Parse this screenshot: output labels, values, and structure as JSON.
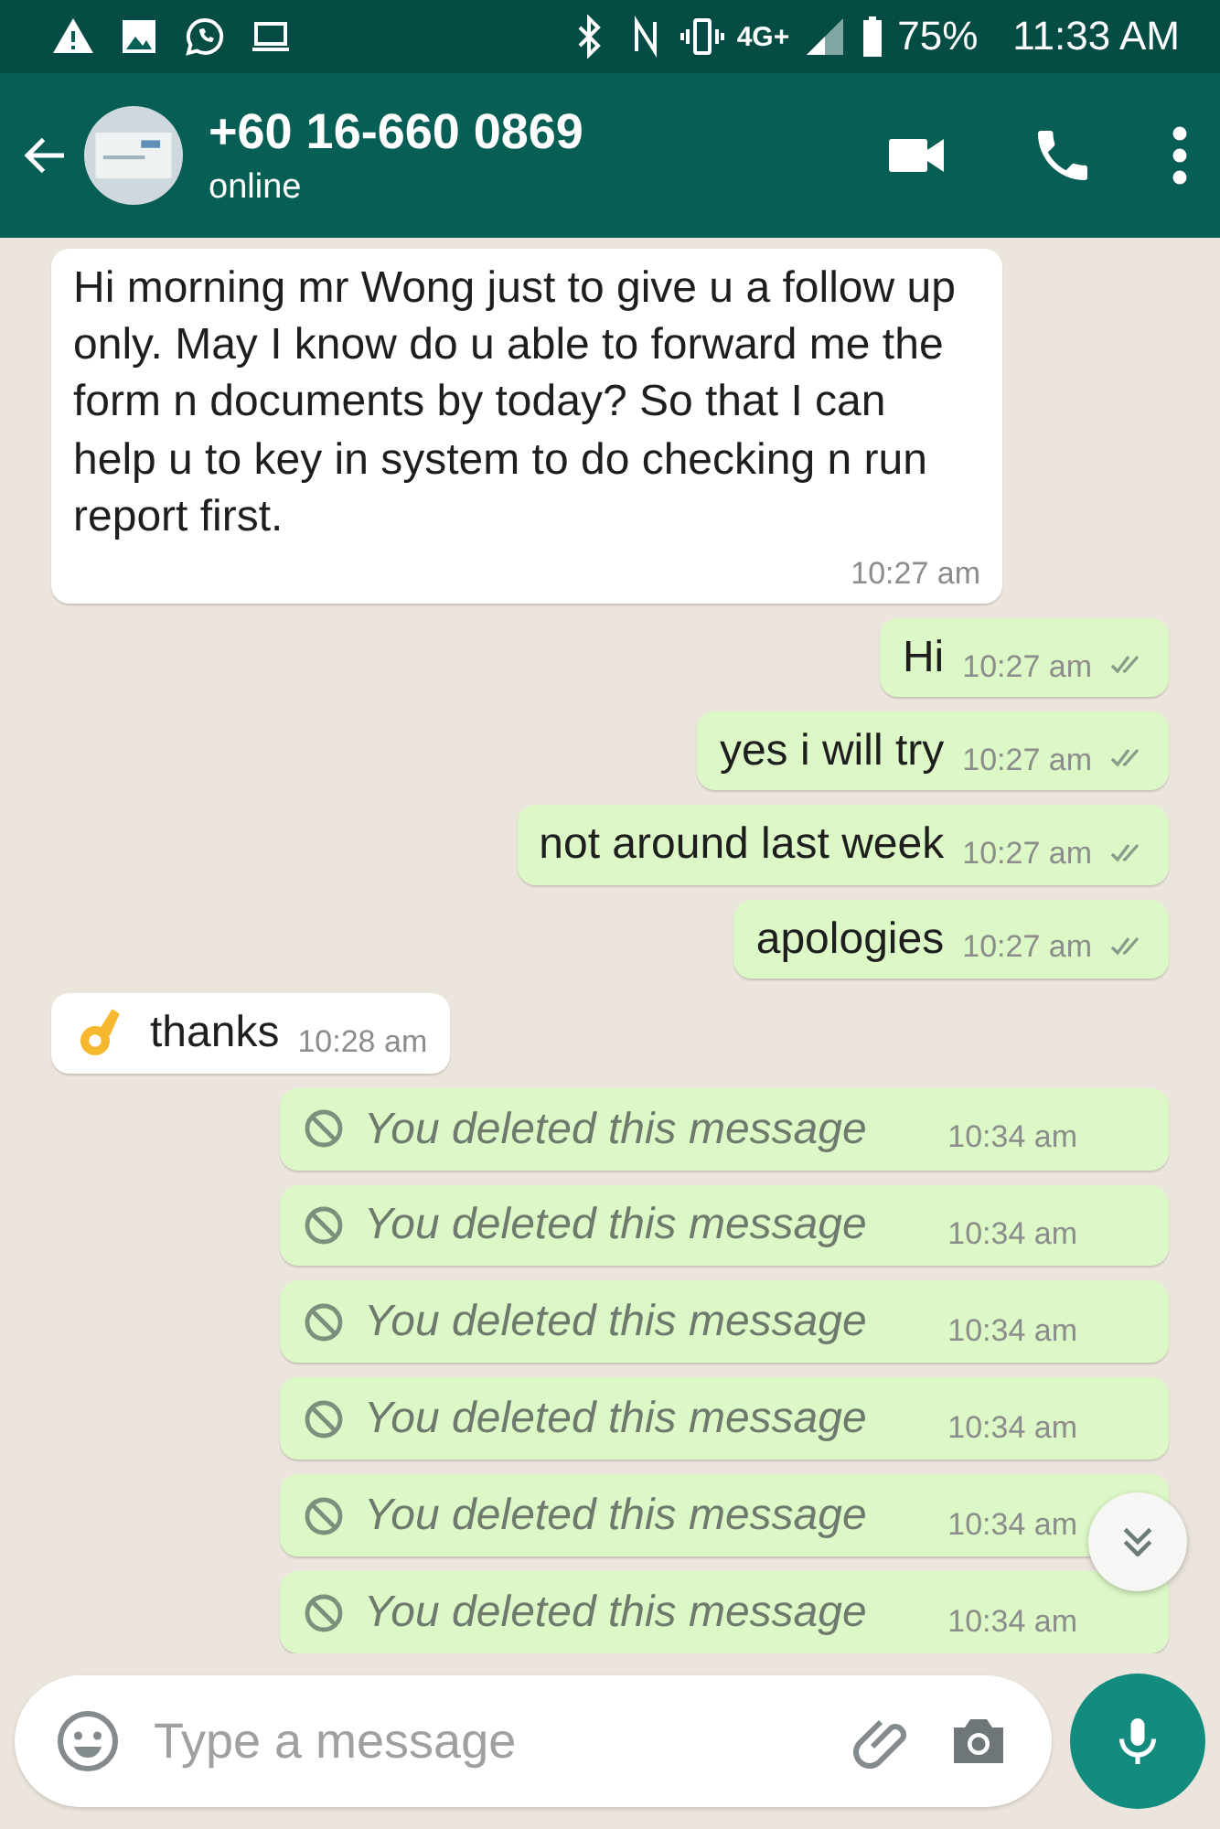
{
  "status_bar": {
    "network": "4G+",
    "battery": "75%",
    "time": "11:33 AM"
  },
  "header": {
    "title": "+60 16-660 0869",
    "subtitle": "online"
  },
  "messages": [
    {
      "kind": "in",
      "text": "Hi morning mr Wong just to give u a follow up only. May I know do u able to forward me the form n documents by today? So that I can help u to key in system to do checking n run report first.",
      "time": "10:27 am"
    },
    {
      "kind": "out",
      "text": "Hi",
      "time": "10:27 am",
      "read": false
    },
    {
      "kind": "out",
      "text": "yes i will try",
      "time": "10:27 am",
      "read": false
    },
    {
      "kind": "out",
      "text": "not around last week",
      "time": "10:27 am",
      "read": false
    },
    {
      "kind": "out",
      "text": "apologies",
      "time": "10:27 am",
      "read": false
    },
    {
      "kind": "in_emoji",
      "text": "thanks",
      "time": "10:28 am"
    },
    {
      "kind": "deleted",
      "text": "You deleted this message",
      "time": "10:34 am"
    },
    {
      "kind": "deleted",
      "text": "You deleted this message",
      "time": "10:34 am"
    },
    {
      "kind": "deleted",
      "text": "You deleted this message",
      "time": "10:34 am"
    },
    {
      "kind": "deleted",
      "text": "You deleted this message",
      "time": "10:34 am"
    },
    {
      "kind": "deleted",
      "text": "You deleted this message",
      "time": "10:34 am"
    },
    {
      "kind": "deleted",
      "text": "You deleted this message",
      "time": "10:34 am"
    }
  ],
  "composer": {
    "placeholder": "Type a message"
  }
}
